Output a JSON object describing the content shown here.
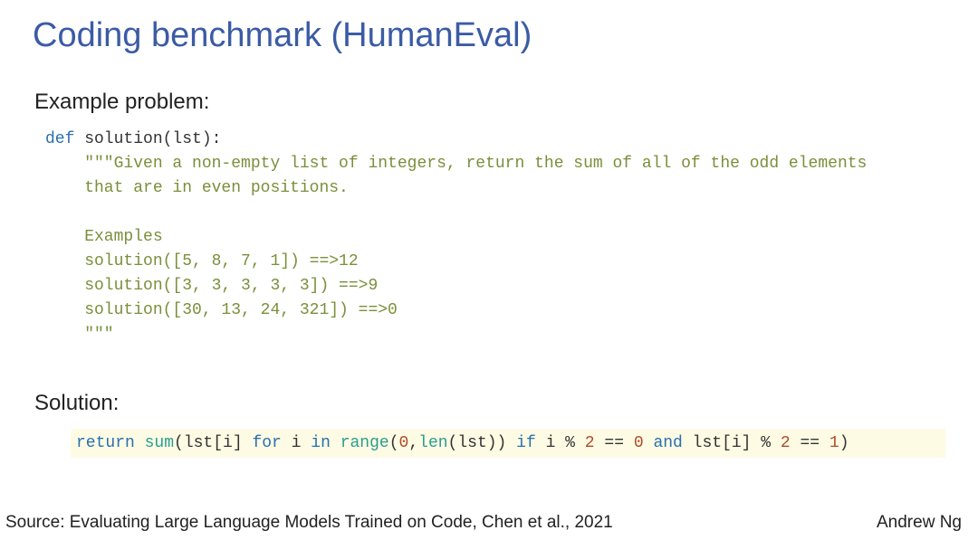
{
  "title": "Coding benchmark (HumanEval)",
  "example": {
    "label": "Example problem:",
    "code": {
      "keyword_def": "def",
      "fn_sig": " solution(lst):",
      "doc_open": "    \"\"\"Given a non-empty list of integers, return the sum of all of the odd elements",
      "doc_l2": "    that are in even positions.",
      "doc_blank": "",
      "doc_ex_hdr": "    Examples",
      "doc_ex1": "    solution([5, 8, 7, 1]) ==>12",
      "doc_ex2": "    solution([3, 3, 3, 3, 3]) ==>9",
      "doc_ex3": "    solution([30, 13, 24, 321]) ==>0",
      "doc_close": "    \"\"\""
    }
  },
  "solution": {
    "label": "Solution:",
    "code": {
      "kw_return": "return",
      "sp1": " ",
      "bi_sum": "sum",
      "p1": "(lst[i] ",
      "kw_for": "for",
      "p2": " i ",
      "kw_in": "in",
      "sp2": " ",
      "bi_range": "range",
      "p3": "(",
      "n0": "0",
      "comma": ",",
      "bi_len": "len",
      "p4": "(lst)) ",
      "kw_if": "if",
      "p5": " i % ",
      "n2a": "2",
      "p6": " == ",
      "n0b": "0",
      "sp3": " ",
      "kw_and": "and",
      "p7": " lst[i] % ",
      "n2b": "2",
      "p8": " == ",
      "n1": "1",
      "p9": ")"
    }
  },
  "footer": {
    "source": "Source: Evaluating Large Language Models Trained on Code, Chen et al., 2021",
    "author": "Andrew Ng"
  }
}
